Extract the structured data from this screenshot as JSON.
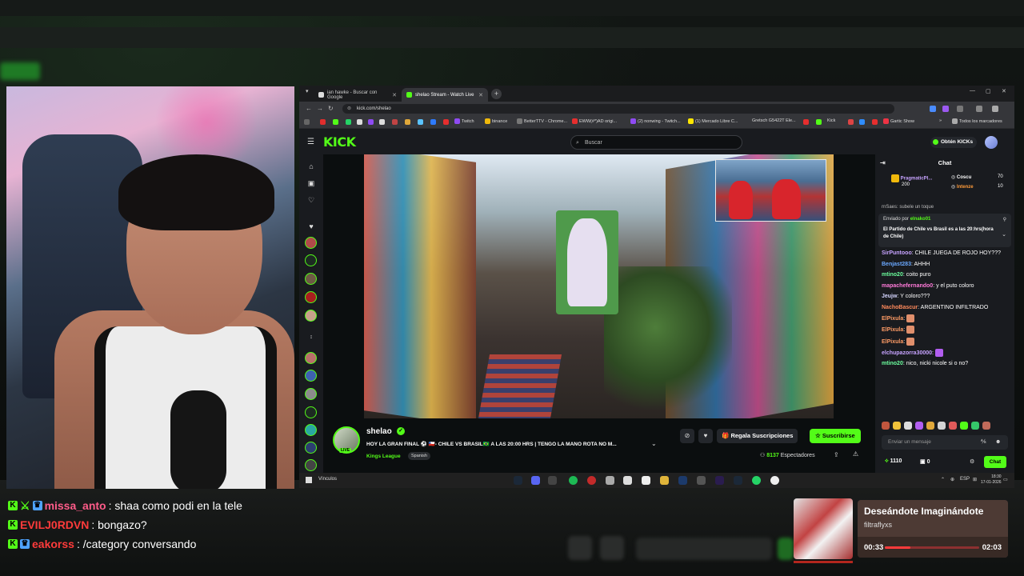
{
  "overlay_chat": [
    {
      "user": "missa_anto",
      "text": ": shaa como podi en la tele",
      "color": "#ff5c8a"
    },
    {
      "user": "EVILJ0RDVN",
      "text": ": bongazo?",
      "color": "#ff3b3b"
    },
    {
      "user": "eakorss",
      "text": ": /category conversando",
      "color": "#ff3b3b"
    }
  ],
  "browser": {
    "tabs": [
      {
        "label": "ian hawke - Buscar con Google"
      },
      {
        "label": "shelao Stream - Watch Live"
      }
    ],
    "url": "kick.com/shelao",
    "bookmarks": [
      "Twitch",
      "binance",
      "BetterTTV - Chrome...",
      "EWW(#*)AD origi...",
      "(2) nonwing - Twitch...",
      "(1) Mercado Libre C...",
      "Gretsch G5422T Ele...",
      "Kick",
      "Gartic Show",
      "Todos los marcadores"
    ]
  },
  "kick": {
    "logo": "KICK",
    "search_placeholder": "Buscar",
    "obtain_label": "Obtén KICKs",
    "stream": {
      "name": "shelao",
      "title": "HOY LA GRAN FINAL ⚽ 🇨🇱- CHILE VS BRASIL🇧🇷 A LAS 20:00 HRS | TENGO LA MANO ROTA NO M...",
      "category": "Kings League",
      "language": "Spanish",
      "live_badge": "LIVE",
      "gift_label": "Regala Suscripciones",
      "subscribe_label": "Suscribirse",
      "viewers": "8137",
      "viewers_label": "Espectadores"
    },
    "chat": {
      "title": "Chat",
      "leaders": [
        {
          "name": "PragmaticPl...",
          "value": "200"
        },
        {
          "name": "Coscu",
          "value": "70"
        },
        {
          "name": "Intenze",
          "value": "10"
        }
      ],
      "truncated_line": "rnSaes: subele un toque",
      "pinned_by_label": "Enviado por",
      "pinned_by_user": "elnako01",
      "pinned_message": "El Partido de Chile vs Brasil es a las 20:hrs(hora de Chile)",
      "messages": [
        {
          "user": "SirPuntooo",
          "text": "CHILE JUEGA DE ROJO HOY???",
          "color": "#c7a3ff"
        },
        {
          "user": "Benjast283",
          "text": "AHHH",
          "color": "#6aa8ff"
        },
        {
          "user": "mtino20",
          "text": "coito puro",
          "color": "#6cff9e"
        },
        {
          "user": "mapachefernando0",
          "text": "y el puto coloro",
          "color": "#ff7ad9"
        },
        {
          "user": "Jeujw",
          "text": "Y coloro???",
          "color": "#d6d6ff"
        },
        {
          "user": "NachoBascur",
          "text": "ARGENTINO INFILTRADO",
          "color": "#ff8a5c"
        },
        {
          "user": "ElPixula",
          "text": "",
          "color": "#ff9c66"
        },
        {
          "user": "ElPixula",
          "text": "",
          "color": "#ff9c66"
        },
        {
          "user": "ElPixula",
          "text": "",
          "color": "#ff9c66"
        },
        {
          "user": "elchupazorra30000",
          "text": "",
          "color": "#c7a3ff"
        },
        {
          "user": "mtino20",
          "text": "nico, nicki nicole si o no?",
          "color": "#6cff9e"
        }
      ],
      "input_placeholder": "Enviar un mensaje",
      "points": "1110",
      "gifts": "0",
      "send_label": "Chat"
    }
  },
  "taskbar": {
    "label": "Vínculos",
    "lang": "ESP",
    "time": "18:30",
    "date": "17-01-2026"
  },
  "now_playing": {
    "title": "Deseándote Imaginándote",
    "artist": "filtraflyxs",
    "elapsed": "00:33",
    "total": "02:03",
    "progress": 0.27
  },
  "colors": {
    "kick_green": "#53fc18",
    "chat_bg": "#191b1f",
    "page_bg": "#0b0e0f"
  }
}
